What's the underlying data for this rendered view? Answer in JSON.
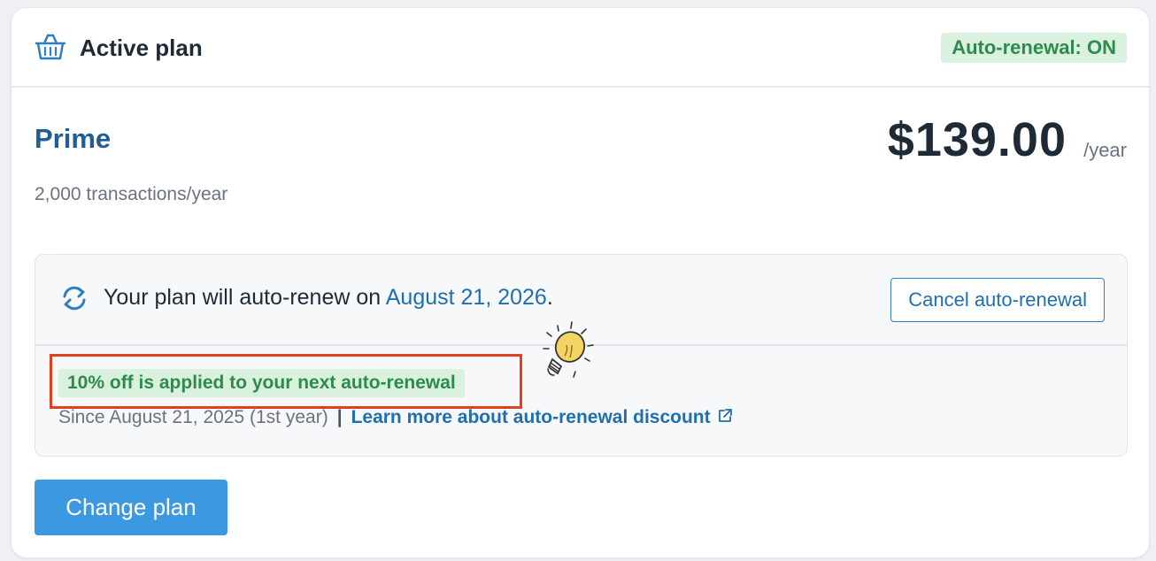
{
  "header": {
    "title": "Active plan",
    "icon": "basket-icon",
    "badge": "Auto-renewal: ON"
  },
  "plan": {
    "name": "Prime",
    "description": "2,000 transactions/year",
    "price": "$139.00",
    "price_unit": "/year"
  },
  "renewal": {
    "icon": "sync-icon",
    "text_prefix": "Your plan will auto-renew on ",
    "date": "August 21, 2026",
    "text_suffix": ".",
    "cancel_label": "Cancel auto-renewal"
  },
  "discount": {
    "badge": "10% off is applied to your next auto-renewal",
    "since": "Since August 21, 2025 (1st year)",
    "separator": "|",
    "learn_more": "Learn more about auto-renewal discount",
    "link_icon": "external-link-icon",
    "decoration_icon": "lightbulb-icon"
  },
  "actions": {
    "change_plan": "Change plan"
  },
  "colors": {
    "accent_blue": "#3d98e2",
    "link_blue": "#1f6fb0",
    "success_green": "#2e8b4e",
    "success_bg": "#d9f1de",
    "highlight_red": "#e0401e"
  }
}
